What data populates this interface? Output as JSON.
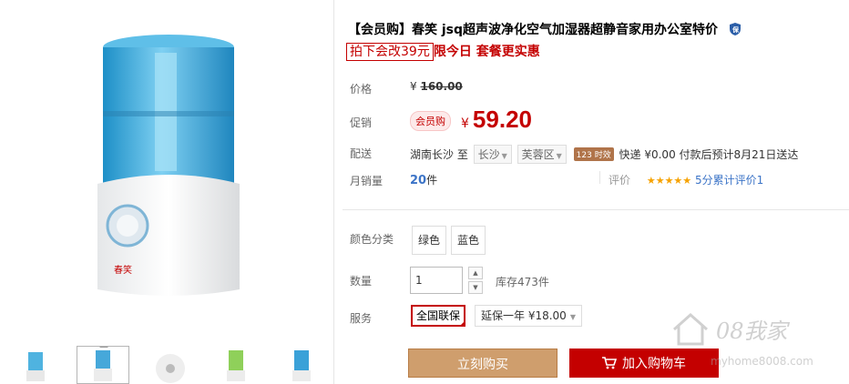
{
  "product": {
    "title": "【会员购】春笑 jsq超声波净化空气加湿器超静音家用办公室特价",
    "promo_boxed": "拍下会改39元",
    "promo_rest": "限今日 套餐更实惠"
  },
  "labels": {
    "price": "价格",
    "promo_price": "促销",
    "delivery": "配送",
    "monthly_sales": "月销量",
    "color": "颜色分类",
    "quantity": "数量",
    "service": "服务"
  },
  "price": {
    "currency": "¥",
    "original": "160.00",
    "member_badge": "会员购",
    "current": "59.20"
  },
  "delivery": {
    "from": "湖南长沙 至",
    "city": "长沙",
    "district": "芙蓉区",
    "time_badge": "123 时效",
    "express": "快递 ¥0.00 付款后预计8月21日送达"
  },
  "sales": {
    "count": "20",
    "unit": "件",
    "review_label": "评价",
    "stars": "★★★★★",
    "review_text": "5分累计评价1"
  },
  "color_options": [
    "绿色",
    "蓝色"
  ],
  "quantity": {
    "value": "1",
    "stock": "库存473件"
  },
  "service": {
    "selected": "全国联保",
    "extended": "延保一年 ¥18.00"
  },
  "buttons": {
    "buy_now": "立刻购买",
    "add_to_cart": "加入购物车"
  },
  "watermark": {
    "brand": "08我家",
    "site": "myhome8008.com"
  },
  "colors": {
    "accent_red": "#c40000",
    "buy_button": "#cf9e6d",
    "link_blue": "#3c74c7",
    "star_orange": "#f6a200"
  },
  "icons": [
    "shield-icon",
    "cart-icon",
    "caret-down-icon",
    "caret-up-icon",
    "house-logo-icon"
  ]
}
